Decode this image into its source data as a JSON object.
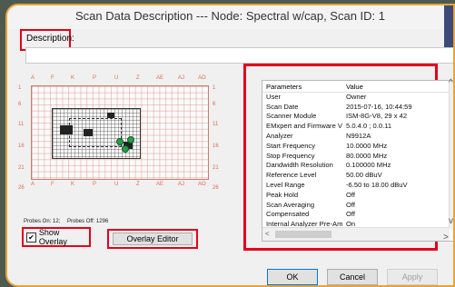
{
  "window": {
    "title": "Scan Data Description --- Node: Spectral w/cap,  Scan ID: 1"
  },
  "description": {
    "label": "Description:",
    "value": ""
  },
  "map": {
    "columns": [
      "A",
      "F",
      "K",
      "P",
      "U",
      "Z",
      "AE",
      "AJ",
      "AO"
    ],
    "rows": [
      "1",
      "6",
      "11",
      "16",
      "21",
      "26"
    ],
    "probes_on": "Probes On: 12;",
    "probes_off": "Probes Off: 1296"
  },
  "controls": {
    "show_overlay_label": "Show Overlay",
    "show_overlay_checked": true,
    "overlay_editor_label": "Overlay Editor"
  },
  "params": {
    "header": [
      "Parameters",
      "Value"
    ],
    "rows": [
      [
        "User",
        "Owner"
      ],
      [
        "Scan Date",
        "2015-07-16,  10:44:59"
      ],
      [
        "Scanner Module",
        "ISM-8G-V8,  29 x 42"
      ],
      [
        "EMxpert and Firmware V...",
        "5.0.4.0  ;  0.0.11"
      ],
      [
        "Analyzer",
        "N9912A"
      ],
      [
        "Start Frequency",
        "10.0000    MHz"
      ],
      [
        "Stop Frequency",
        "80.0000    MHz"
      ],
      [
        "Dandwidth Resolution",
        "0.100000    MHz"
      ],
      [
        "Reference Level",
        "50.00   dBuV"
      ],
      [
        "Level Range",
        "-6.50   to  18.00   dBuV"
      ],
      [
        "Peak Hold",
        "Off"
      ],
      [
        "Scan Averaging",
        "Off"
      ],
      [
        "Compensated",
        "Off"
      ],
      [
        "Internal Analyzer Pre-Amp...",
        "On"
      ]
    ]
  },
  "buttons": {
    "ok": "OK",
    "cancel": "Cancel",
    "apply": "Apply"
  }
}
